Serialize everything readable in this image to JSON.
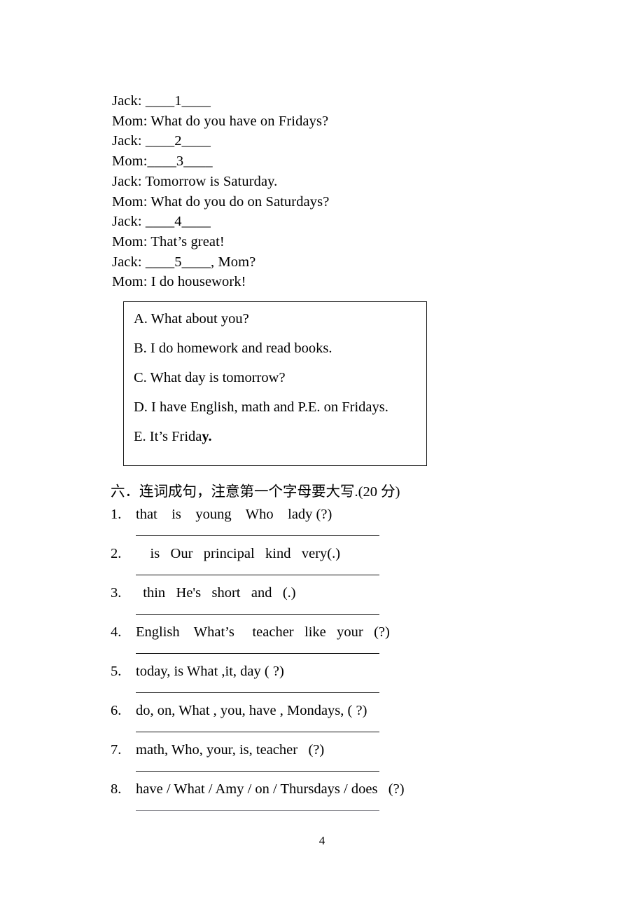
{
  "document": {
    "page_number": "4"
  },
  "dialogue": {
    "lines": [
      "Jack: ____1____",
      "Mom: What do you have on Fridays?",
      "Jack: ____2____",
      "Mom:____3____",
      "Jack: Tomorrow is Saturday.",
      "Mom: What do you do on Saturdays?",
      "Jack: ____4____",
      "Mom: That’s great!",
      "Jack: ____5____, Mom?",
      "Mom: I do housework!"
    ]
  },
  "options_box": {
    "options": [
      {
        "text": "A. What about you?",
        "bold_tail": ""
      },
      {
        "text": "B. I do homework and read books.",
        "bold_tail": ""
      },
      {
        "text": "C. What day is tomorrow?",
        "bold_tail": ""
      },
      {
        "text": "D. I have English, math and P.E. on Fridays.",
        "bold_tail": ""
      },
      {
        "text": "E. It’s Frida",
        "bold_tail": "y."
      }
    ]
  },
  "section": {
    "heading_cn": "六．连词成句，注意第一个字母要大写",
    "heading_score": ".(20 分)"
  },
  "items": [
    {
      "number": "1.",
      "text": "that    is    young    Who    lady (?)"
    },
    {
      "number": "2.",
      "text": "    is   Our   principal   kind   very(.)"
    },
    {
      "number": "3.",
      "text": "  thin   He's   short   and   (.)"
    },
    {
      "number": "4.",
      "text": "English    What’s     teacher   like   your   (?)"
    },
    {
      "number": "5.",
      "text": "today, is What ,it, day ( ?)"
    },
    {
      "number": "6.",
      "text": "do, on, What , you, have , Mondays, ( ?)"
    },
    {
      "number": "7.",
      "text": "math, Who, your, is, teacher   (?)"
    },
    {
      "number": "8.",
      "text": "have / What / Amy / on / Thursdays / does   (?)"
    }
  ]
}
